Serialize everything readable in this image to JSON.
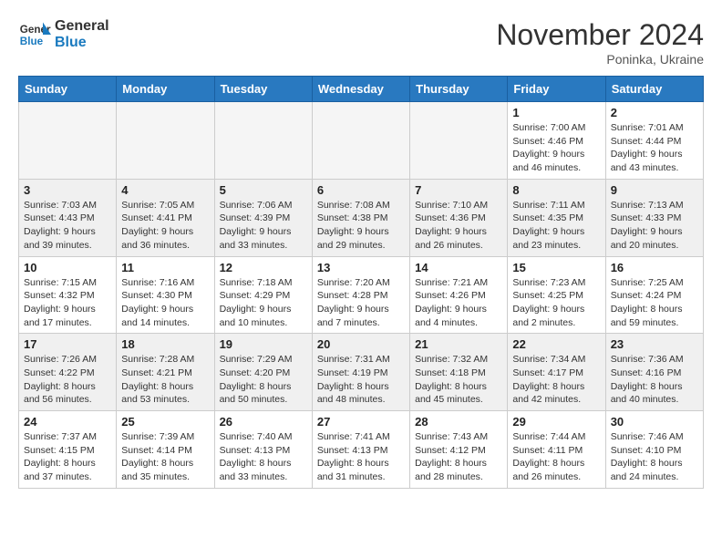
{
  "logo": {
    "line1": "General",
    "line2": "Blue"
  },
  "title": "November 2024",
  "location": "Poninka, Ukraine",
  "weekdays": [
    "Sunday",
    "Monday",
    "Tuesday",
    "Wednesday",
    "Thursday",
    "Friday",
    "Saturday"
  ],
  "weeks": [
    [
      {
        "day": "",
        "info": ""
      },
      {
        "day": "",
        "info": ""
      },
      {
        "day": "",
        "info": ""
      },
      {
        "day": "",
        "info": ""
      },
      {
        "day": "",
        "info": ""
      },
      {
        "day": "1",
        "info": "Sunrise: 7:00 AM\nSunset: 4:46 PM\nDaylight: 9 hours\nand 46 minutes."
      },
      {
        "day": "2",
        "info": "Sunrise: 7:01 AM\nSunset: 4:44 PM\nDaylight: 9 hours\nand 43 minutes."
      }
    ],
    [
      {
        "day": "3",
        "info": "Sunrise: 7:03 AM\nSunset: 4:43 PM\nDaylight: 9 hours\nand 39 minutes."
      },
      {
        "day": "4",
        "info": "Sunrise: 7:05 AM\nSunset: 4:41 PM\nDaylight: 9 hours\nand 36 minutes."
      },
      {
        "day": "5",
        "info": "Sunrise: 7:06 AM\nSunset: 4:39 PM\nDaylight: 9 hours\nand 33 minutes."
      },
      {
        "day": "6",
        "info": "Sunrise: 7:08 AM\nSunset: 4:38 PM\nDaylight: 9 hours\nand 29 minutes."
      },
      {
        "day": "7",
        "info": "Sunrise: 7:10 AM\nSunset: 4:36 PM\nDaylight: 9 hours\nand 26 minutes."
      },
      {
        "day": "8",
        "info": "Sunrise: 7:11 AM\nSunset: 4:35 PM\nDaylight: 9 hours\nand 23 minutes."
      },
      {
        "day": "9",
        "info": "Sunrise: 7:13 AM\nSunset: 4:33 PM\nDaylight: 9 hours\nand 20 minutes."
      }
    ],
    [
      {
        "day": "10",
        "info": "Sunrise: 7:15 AM\nSunset: 4:32 PM\nDaylight: 9 hours\nand 17 minutes."
      },
      {
        "day": "11",
        "info": "Sunrise: 7:16 AM\nSunset: 4:30 PM\nDaylight: 9 hours\nand 14 minutes."
      },
      {
        "day": "12",
        "info": "Sunrise: 7:18 AM\nSunset: 4:29 PM\nDaylight: 9 hours\nand 10 minutes."
      },
      {
        "day": "13",
        "info": "Sunrise: 7:20 AM\nSunset: 4:28 PM\nDaylight: 9 hours\nand 7 minutes."
      },
      {
        "day": "14",
        "info": "Sunrise: 7:21 AM\nSunset: 4:26 PM\nDaylight: 9 hours\nand 4 minutes."
      },
      {
        "day": "15",
        "info": "Sunrise: 7:23 AM\nSunset: 4:25 PM\nDaylight: 9 hours\nand 2 minutes."
      },
      {
        "day": "16",
        "info": "Sunrise: 7:25 AM\nSunset: 4:24 PM\nDaylight: 8 hours\nand 59 minutes."
      }
    ],
    [
      {
        "day": "17",
        "info": "Sunrise: 7:26 AM\nSunset: 4:22 PM\nDaylight: 8 hours\nand 56 minutes."
      },
      {
        "day": "18",
        "info": "Sunrise: 7:28 AM\nSunset: 4:21 PM\nDaylight: 8 hours\nand 53 minutes."
      },
      {
        "day": "19",
        "info": "Sunrise: 7:29 AM\nSunset: 4:20 PM\nDaylight: 8 hours\nand 50 minutes."
      },
      {
        "day": "20",
        "info": "Sunrise: 7:31 AM\nSunset: 4:19 PM\nDaylight: 8 hours\nand 48 minutes."
      },
      {
        "day": "21",
        "info": "Sunrise: 7:32 AM\nSunset: 4:18 PM\nDaylight: 8 hours\nand 45 minutes."
      },
      {
        "day": "22",
        "info": "Sunrise: 7:34 AM\nSunset: 4:17 PM\nDaylight: 8 hours\nand 42 minutes."
      },
      {
        "day": "23",
        "info": "Sunrise: 7:36 AM\nSunset: 4:16 PM\nDaylight: 8 hours\nand 40 minutes."
      }
    ],
    [
      {
        "day": "24",
        "info": "Sunrise: 7:37 AM\nSunset: 4:15 PM\nDaylight: 8 hours\nand 37 minutes."
      },
      {
        "day": "25",
        "info": "Sunrise: 7:39 AM\nSunset: 4:14 PM\nDaylight: 8 hours\nand 35 minutes."
      },
      {
        "day": "26",
        "info": "Sunrise: 7:40 AM\nSunset: 4:13 PM\nDaylight: 8 hours\nand 33 minutes."
      },
      {
        "day": "27",
        "info": "Sunrise: 7:41 AM\nSunset: 4:13 PM\nDaylight: 8 hours\nand 31 minutes."
      },
      {
        "day": "28",
        "info": "Sunrise: 7:43 AM\nSunset: 4:12 PM\nDaylight: 8 hours\nand 28 minutes."
      },
      {
        "day": "29",
        "info": "Sunrise: 7:44 AM\nSunset: 4:11 PM\nDaylight: 8 hours\nand 26 minutes."
      },
      {
        "day": "30",
        "info": "Sunrise: 7:46 AM\nSunset: 4:10 PM\nDaylight: 8 hours\nand 24 minutes."
      }
    ]
  ]
}
